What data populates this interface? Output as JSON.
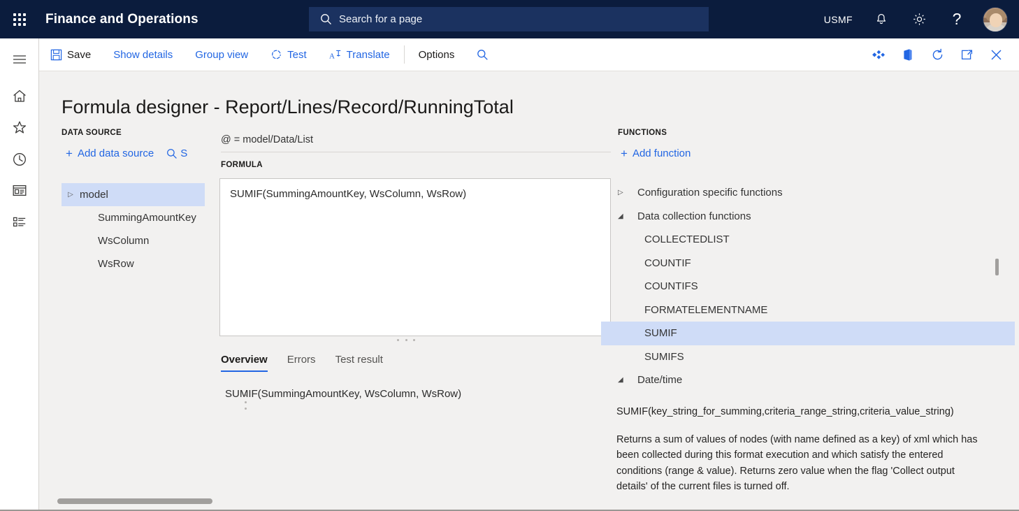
{
  "topbar": {
    "waffle_icon": "app-launcher-icon",
    "app_title": "Finance and Operations",
    "search": {
      "icon": "search-icon",
      "placeholder": "Search for a page",
      "value": ""
    },
    "company": "USMF",
    "notifications_icon": "bell-icon",
    "settings_icon": "gear-icon",
    "help_label": "?",
    "avatar": "user-avatar"
  },
  "rail": {
    "items": [
      {
        "name": "hamburger-icon",
        "label": "Expand the navigation pane"
      },
      {
        "name": "home-icon",
        "label": "Home"
      },
      {
        "name": "star-icon",
        "label": "Favorites"
      },
      {
        "name": "clock-icon",
        "label": "Recent"
      },
      {
        "name": "workspaces-icon",
        "label": "Workspaces"
      },
      {
        "name": "modules-icon",
        "label": "Modules"
      }
    ]
  },
  "toolbar": {
    "save_label": "Save",
    "show_details_label": "Show details",
    "group_view_label": "Group view",
    "test_label": "Test",
    "translate_label": "Translate",
    "options_label": "Options",
    "search_icon": "search-icon",
    "right_icons": [
      "attach-icon",
      "office-app-icon",
      "refresh-icon",
      "open-in-new-window-icon",
      "close-icon"
    ]
  },
  "page": {
    "title": "Formula designer - Report/Lines/Record/RunningTotal"
  },
  "data_source": {
    "label": "DATA SOURCE",
    "add_label": "Add data source",
    "search_label": "S",
    "tree": [
      {
        "label": "model",
        "twisty": "collapsed",
        "selected": true,
        "child": false
      },
      {
        "label": "SummingAmountKey",
        "twisty": "none",
        "selected": false,
        "child": true
      },
      {
        "label": "WsColumn",
        "twisty": "none",
        "selected": false,
        "child": true
      },
      {
        "label": "WsRow",
        "twisty": "none",
        "selected": false,
        "child": true
      }
    ]
  },
  "formula": {
    "binding": "@ = model/Data/List",
    "label": "FORMULA",
    "value": "SUMIF(SummingAmountKey, WsColumn, WsRow)",
    "tabs": [
      {
        "label": "Overview",
        "active": true
      },
      {
        "label": "Errors",
        "active": false
      },
      {
        "label": "Test result",
        "active": false
      }
    ],
    "overview_text": "SUMIF(SummingAmountKey, WsColumn, WsRow)"
  },
  "functions": {
    "label": "FUNCTIONS",
    "add_label": "Add function",
    "tree": [
      {
        "label": "Configuration specific functions",
        "twisty": "collapsed",
        "selected": false,
        "leaf": false
      },
      {
        "label": "Data collection functions",
        "twisty": "expanded",
        "selected": false,
        "leaf": false
      },
      {
        "label": "COLLECTEDLIST",
        "twisty": "none",
        "selected": false,
        "leaf": true
      },
      {
        "label": "COUNTIF",
        "twisty": "none",
        "selected": false,
        "leaf": true
      },
      {
        "label": "COUNTIFS",
        "twisty": "none",
        "selected": false,
        "leaf": true
      },
      {
        "label": "FORMATELEMENTNAME",
        "twisty": "none",
        "selected": false,
        "leaf": true
      },
      {
        "label": "SUMIF",
        "twisty": "none",
        "selected": true,
        "leaf": true
      },
      {
        "label": "SUMIFS",
        "twisty": "none",
        "selected": false,
        "leaf": true
      },
      {
        "label": "Date/time",
        "twisty": "expanded",
        "selected": false,
        "leaf": false
      }
    ]
  },
  "description": {
    "signature": "SUMIF(key_string_for_summing,criteria_range_string,criteria_value_string)",
    "body": "Returns a sum of values of nodes (with name defined as a key) of xml which has been collected during this format execution and which satisfy the entered conditions (range & value). Returns zero value when the flag 'Collect output details' of the current files is turned off.",
    "scroll_up_icon": "chevron-up-icon",
    "scroll_down_icon": "chevron-down-icon"
  },
  "colors": {
    "header_bg": "#0b1c3d",
    "search_bg": "#1b3260",
    "accent_link": "#2266e3",
    "page_bg": "#f2f1f0",
    "selection_bg": "#cfdcf7"
  }
}
